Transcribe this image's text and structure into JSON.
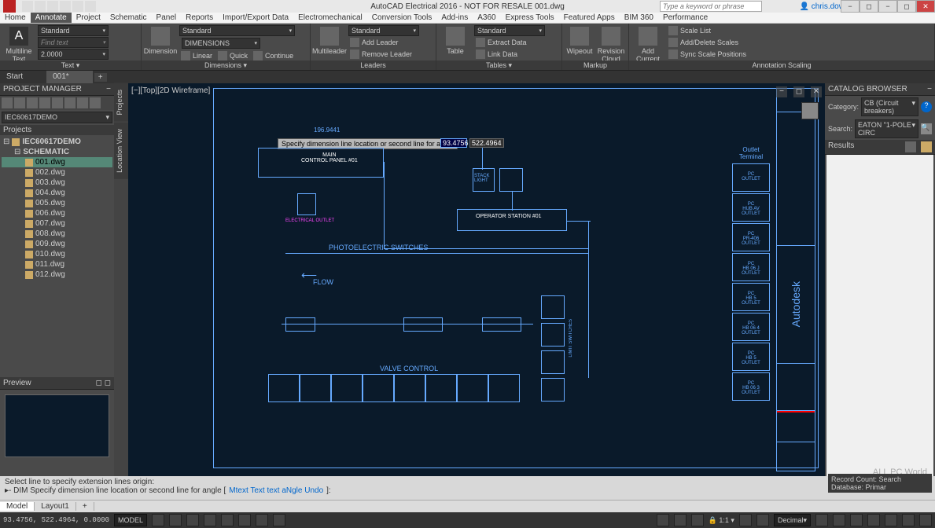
{
  "app": {
    "title": "AutoCAD Electrical 2016 - NOT FOR RESALE   001.dwg",
    "search_placeholder": "Type a keyword or phrase",
    "user": "chris.downing..."
  },
  "menutabs": [
    "Home",
    "Annotate",
    "Project",
    "Schematic",
    "Panel",
    "Reports",
    "Import/Export Data",
    "Electromechanical",
    "Conversion Tools",
    "Add-ins",
    "A360",
    "Express Tools",
    "Featured Apps",
    "BIM 360",
    "Performance"
  ],
  "active_tab": "Annotate",
  "ribbon": {
    "text": {
      "label": "Text ▾",
      "big": "Multiline\nText",
      "style": "Standard",
      "find": "Find text",
      "height": "2.0000"
    },
    "dimensions": {
      "label": "Dimensions ▾",
      "big": "Dimension",
      "style": "Standard",
      "layer": "DIMENSIONS",
      "linear": "Linear",
      "quick": "Quick",
      "continue": "Continue"
    },
    "leaders": {
      "label": "Leaders",
      "big": "Multileader",
      "style": "Standard",
      "add": "Add Leader",
      "remove": "Remove Leader"
    },
    "tables": {
      "label": "Tables ▾",
      "big": "Table",
      "style": "Standard",
      "extract": "Extract Data",
      "link": "Link Data"
    },
    "markup": {
      "label": "Markup",
      "wipeout": "Wipeout",
      "cloud": "Revision\nCloud"
    },
    "scaling": {
      "label": "Annotation Scaling",
      "add": "Add\nCurrent Scale",
      "list": "Scale List",
      "adddel": "Add/Delete Scales",
      "sync": "Sync Scale Positions"
    }
  },
  "doctabs": {
    "start": "Start",
    "file": "001*"
  },
  "pm": {
    "title": "PROJECT MANAGER",
    "project": "IEC60617DEMO",
    "projects_label": "Projects",
    "root": "IEC60617DEMO",
    "schematic": "SCHEMATIC",
    "files": [
      "001.dwg",
      "002.dwg",
      "003.dwg",
      "004.dwg",
      "005.dwg",
      "006.dwg",
      "007.dwg",
      "008.dwg",
      "009.dwg",
      "010.dwg",
      "011.dwg",
      "012.dwg"
    ],
    "selected": "001.dwg",
    "preview": "Preview"
  },
  "vtabs": [
    "Projects",
    "Location View"
  ],
  "canvas": {
    "viewlabel": "[−][Top][2D Wireframe]",
    "prompt": "Specify dimension line location or second line for angle",
    "input_val": "93.4756",
    "static_val": "522.4964",
    "dim_text": "196.9441",
    "main_panel": "MAIN\nCONTROL PANEL #01",
    "stack": "STACK\nLIGHT",
    "opstation": "OPERATOR STATION #01",
    "photo": "PHOTOELECTRIC SWITCHES",
    "flow": "FLOW",
    "valve": "VALVE CONTROL",
    "outlet_title": "Outlet Terminal",
    "autodesk": "Autodesk",
    "outlets": [
      "PC\nOUTLET",
      "PC\nHUB AV\nOUTLET",
      "PC\nPR-406\nOUTLET",
      "PC\nHB 06 J\nOUTLET",
      "PC\nHB 5\nOUTLET",
      "PC\nHB 06 4\nOUTLET",
      "PC\nHB 5\nOUTLET",
      "PC\nHB 06 3\nOUTLET"
    ],
    "limit_sw": "LIMIT SWITCHES"
  },
  "catalog": {
    "title": "CATALOG BROWSER",
    "cat_label": "Category:",
    "cat_val": "CB (Circuit breakers)",
    "search_label": "Search:",
    "search_val": "EATON \"1-POLE CIRC",
    "results": "Results",
    "record": "Record Count: Search Database: Primar"
  },
  "cmdline": {
    "l1": "Select line to specify extension lines origin:",
    "l2_prefix": "▸- DIM Specify dimension line location or second line for angle [",
    "opts": "Mtext Text text aNgle Undo",
    "l2_suffix": "]:"
  },
  "bottom": {
    "model": "Model",
    "layout": "Layout1"
  },
  "status": {
    "coords": "93.4756, 522.4964, 0.0000",
    "mode": "MODEL",
    "scale": "1:1",
    "units": "Decimal"
  },
  "watermark": "ALL PC World"
}
